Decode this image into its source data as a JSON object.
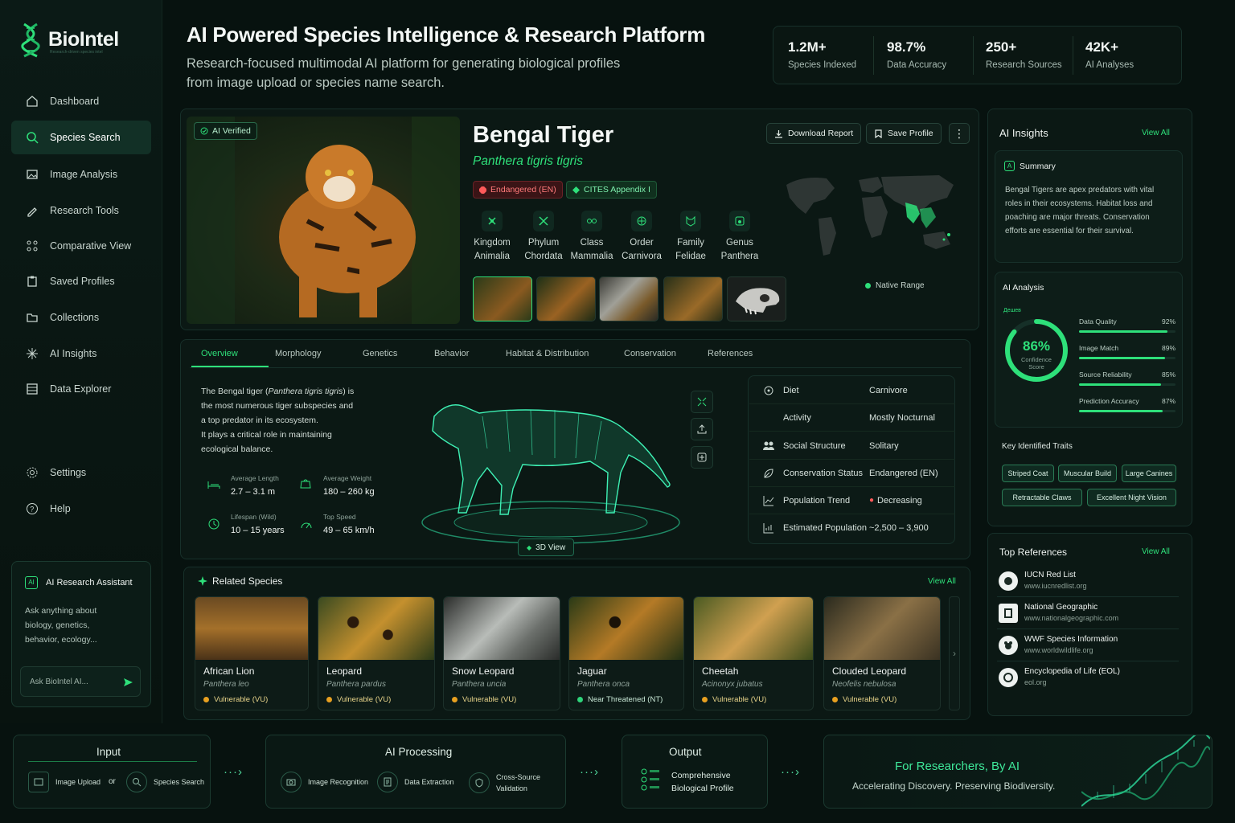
{
  "brand": {
    "name": "BioIntel",
    "tagline": "Research-driven species intel"
  },
  "nav": {
    "items": [
      "Dashboard",
      "Species Search",
      "Image Analysis",
      "Research Tools",
      "Comparative View",
      "Saved Profiles",
      "Collections",
      "AI Insights",
      "Data Explorer"
    ],
    "active": "Species Search",
    "bottom": [
      "Settings",
      "Help"
    ]
  },
  "assistant": {
    "title": "AI Research Assistant",
    "badge": "AI",
    "body": "Ask anything about biology, genetics, behavior, ecology...",
    "placeholder": "Ask BioIntel AI..."
  },
  "header": {
    "title": "AI Powered Species Intelligence & Research Platform",
    "subtitle_line1": "Research-focused multimodal AI platform for generating biological profiles",
    "subtitle_line2": "from image upload or species name search."
  },
  "stats": [
    {
      "value": "1.2M+",
      "label": "Species Indexed"
    },
    {
      "value": "98.7%",
      "label": "Data Accuracy"
    },
    {
      "value": "250+",
      "label": "Research Sources"
    },
    {
      "value": "42K+",
      "label": "AI Analyses"
    }
  ],
  "species": {
    "verified": "AI Verified",
    "name": "Bengal Tiger",
    "scientific": "Panthera tigris tigris",
    "status_badge": "Endangered (EN)",
    "cites_badge": "CITES Appendix I",
    "download": "Download Report",
    "save": "Save Profile",
    "native_range": "Native Range",
    "taxonomy": [
      {
        "rank": "Kingdom",
        "value": "Animalia"
      },
      {
        "rank": "Phylum",
        "value": "Chordata"
      },
      {
        "rank": "Class",
        "value": "Mammalia"
      },
      {
        "rank": "Order",
        "value": "Carnivora"
      },
      {
        "rank": "Family",
        "value": "Felidae"
      },
      {
        "rank": "Genus",
        "value": "Panthera"
      }
    ]
  },
  "tabs": [
    "Overview",
    "Morphology",
    "Genetics",
    "Behavior",
    "Habitat & Distribution",
    "Conservation",
    "References"
  ],
  "overview": {
    "desc_prefix": "The Bengal tiger (",
    "desc_sci": "Panthera tigris tigris",
    "desc_after": ") is",
    "desc_lines": [
      "the most numerous tiger subspecies and",
      "a top predator in its ecosystem.",
      "It plays a critical role in maintaining",
      "ecological balance."
    ],
    "metrics": [
      {
        "label": "Average Length",
        "value": "2.7 – 3.1 m"
      },
      {
        "label": "Average Weight",
        "value": "180 – 260 kg"
      },
      {
        "label": "Lifespan (Wild)",
        "value": "10 – 15 years"
      },
      {
        "label": "Top Speed",
        "value": "49 – 65 km/h"
      }
    ],
    "view3d": "3D View"
  },
  "traits_table": [
    {
      "key": "Diet",
      "value": "Carnivore"
    },
    {
      "key": "Activity",
      "value": "Mostly Nocturnal"
    },
    {
      "key": "Social Structure",
      "value": "Solitary"
    },
    {
      "key": "Conservation Status",
      "value": "Endangered (EN)"
    },
    {
      "key": "Population Trend",
      "value": "Decreasing"
    },
    {
      "key": "Estimated Population",
      "value": "~2,500 – 3,900"
    }
  ],
  "related": {
    "title": "Related Species",
    "view_all": "View All",
    "items": [
      {
        "name": "African Lion",
        "sci": "Panthera leo",
        "status": "Vulnerable (VU)",
        "color": "#e8a020"
      },
      {
        "name": "Leopard",
        "sci": "Panthera pardus",
        "status": "Vulnerable (VU)",
        "color": "#e8a020"
      },
      {
        "name": "Snow Leopard",
        "sci": "Panthera uncia",
        "status": "Vulnerable (VU)",
        "color": "#e8a020"
      },
      {
        "name": "Jaguar",
        "sci": "Panthera onca",
        "status": "Near Threatened (NT)",
        "color": "#2ed47a"
      },
      {
        "name": "Cheetah",
        "sci": "Acinonyx jubatus",
        "status": "Vulnerable (VU)",
        "color": "#e8a020"
      },
      {
        "name": "Clouded Leopard",
        "sci": "Neofelis nebulosa",
        "status": "Vulnerable (VU)",
        "color": "#e8a020"
      }
    ]
  },
  "insights": {
    "title": "AI Insights",
    "view_all": "View All",
    "summary_title": "Summary",
    "summary": "Bengal Tigers are apex predators with vital roles in their ecosystems. Habitat loss and poaching are major threats. Conservation efforts are essential for their survival.",
    "analysis_title": "AI Analysis",
    "analysis_small": "Дешев",
    "confidence": {
      "value": "86%",
      "fraction": 0.86,
      "label": "Confidence Score"
    },
    "metrics": [
      {
        "label": "Data Quality",
        "value": "92%",
        "fraction": 0.92
      },
      {
        "label": "Image Match",
        "value": "89%",
        "fraction": 0.89
      },
      {
        "label": "Source Reliability",
        "value": "85%",
        "fraction": 0.85
      },
      {
        "label": "Prediction Accuracy",
        "value": "87%",
        "fraction": 0.87
      }
    ],
    "traits_title": "Key Identified Traits",
    "traits": [
      "Striped Coat",
      "Muscular Build",
      "Large Canines",
      "Retractable Claws",
      "Excellent Night Vision"
    ]
  },
  "references": {
    "title": "Top References",
    "view_all": "View All",
    "items": [
      {
        "name": "IUCN Red List",
        "url": "www.iucnredlist.org"
      },
      {
        "name": "National Geographic",
        "url": "www.nationalgeographic.com"
      },
      {
        "name": "WWF Species Information",
        "url": "www.worldwildlife.org"
      },
      {
        "name": "Encyclopedia of Life (EOL)",
        "url": "eol.org"
      }
    ]
  },
  "pipeline": {
    "input_title": "Input",
    "image_upload": "Image Upload",
    "or": "or",
    "species_search": "Species Search",
    "processing_title": "AI Processing",
    "image_recognition": "Image Recognition",
    "data_extraction": "Data Extraction",
    "cross_source_1": "Cross-Source",
    "cross_source_2": "Validation",
    "output_title": "Output",
    "output_1": "Comprehensive",
    "output_2": "Biological Profile",
    "tag_title": "For Researchers, By AI",
    "tag_sub": "Accelerating Discovery. Preserving Biodiversity."
  },
  "colors": {
    "accent": "#2ee07a",
    "danger": "#ff5a5a",
    "warning": "#e8a020",
    "bg": "#07120f"
  }
}
